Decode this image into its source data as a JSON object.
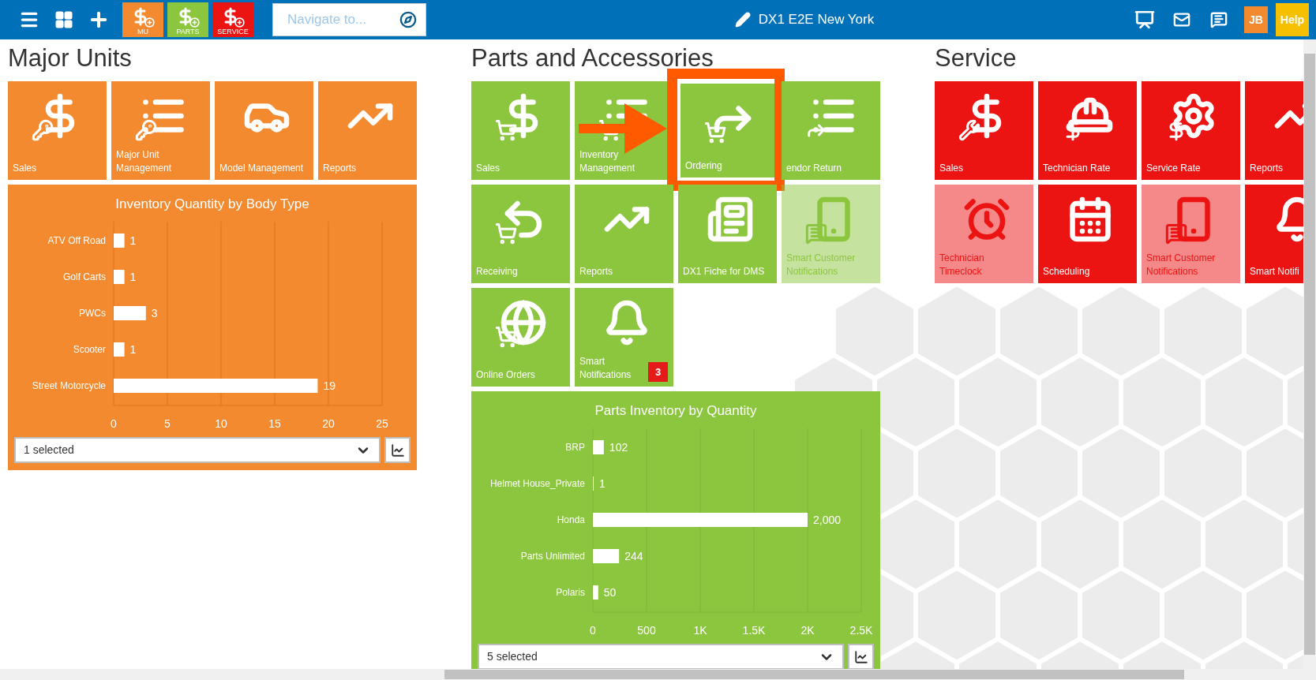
{
  "topbar": {
    "module_buttons": [
      {
        "label": "MU",
        "color": "#f38a2f"
      },
      {
        "label": "PARTS",
        "color": "#8cc63f"
      },
      {
        "label": "SERVICE",
        "color": "#ec1313"
      }
    ],
    "search": {
      "placeholder": "Navigate to..."
    },
    "title": "DX1 E2E New York",
    "user_initials": "JB",
    "help": "Help"
  },
  "sections": [
    {
      "title": "Major Units",
      "color": "#f38a2f",
      "tiles": [
        {
          "label": "Sales",
          "disabled": false,
          "highlighted": false
        },
        {
          "label": "Major Unit Management",
          "disabled": false,
          "highlighted": false
        },
        {
          "label": "Model Management",
          "disabled": false,
          "highlighted": false
        },
        {
          "label": "Reports",
          "disabled": false,
          "highlighted": false
        }
      ],
      "chart": {
        "selector": "1 selected",
        "chart_data": {
          "type": "bar",
          "orientation": "horizontal",
          "title": "Inventory Quantity by Body Type",
          "categories": [
            "ATV Off Road",
            "Golf Carts",
            "PWCs",
            "Scooter",
            "Street Motorcycle"
          ],
          "values": [
            1,
            1,
            3,
            1,
            19
          ],
          "value_labels": [
            "1",
            "1",
            "3",
            "1",
            "19"
          ],
          "grid": true,
          "xlim": [
            0,
            25
          ],
          "xticks": [
            0,
            5,
            10,
            15,
            20,
            25
          ]
        }
      }
    },
    {
      "title": "Parts and Accessories",
      "color": "#8cc63f",
      "tiles": [
        {
          "label": "Sales",
          "disabled": false,
          "highlighted": false
        },
        {
          "label": "Inventory Management",
          "disabled": false,
          "highlighted": false
        },
        {
          "label": "Ordering",
          "disabled": false,
          "highlighted": true
        },
        {
          "label": "endor Return",
          "disabled": false,
          "highlighted": false
        },
        {
          "label": "Receiving",
          "disabled": false,
          "highlighted": false
        },
        {
          "label": "Reports",
          "disabled": false,
          "highlighted": false
        },
        {
          "label": "DX1 Fiche for DMS",
          "disabled": false,
          "highlighted": false
        },
        {
          "label": "Smart Customer Notifications",
          "disabled": true,
          "highlighted": false
        },
        {
          "label": "Online Orders",
          "disabled": false,
          "highlighted": false
        },
        {
          "label": "Smart Notifications",
          "disabled": false,
          "highlighted": false,
          "badge": "3"
        }
      ],
      "chart": {
        "selector": "5 selected",
        "chart_data": {
          "type": "bar",
          "orientation": "horizontal",
          "title": "Parts Inventory by Quantity",
          "categories": [
            "BRP",
            "Helmet House_Private",
            "Honda",
            "Parts Unlimited",
            "Polaris"
          ],
          "values": [
            102,
            1,
            2000,
            244,
            50
          ],
          "value_labels": [
            "102",
            "1",
            "2,000",
            "244",
            "50"
          ],
          "grid": true,
          "xlim": [
            0,
            2500
          ],
          "xticks": [
            0,
            {
              "value": 500,
              "label": "500"
            },
            {
              "value": 1000,
              "label": "1K"
            },
            {
              "value": 1500,
              "label": "1.5K"
            },
            {
              "value": 2000,
              "label": "2K"
            },
            {
              "value": 2500,
              "label": "2.5K"
            }
          ]
        }
      }
    },
    {
      "title": "Service",
      "color": "#ec1313",
      "tiles": [
        {
          "label": "Sales",
          "disabled": false,
          "highlighted": false
        },
        {
          "label": "Technician Rate",
          "disabled": false,
          "highlighted": false
        },
        {
          "label": "Service Rate",
          "disabled": false,
          "highlighted": false
        },
        {
          "label": "Reports",
          "disabled": false,
          "highlighted": false
        },
        {
          "label": "Technician Timeclock",
          "disabled": true,
          "highlighted": false
        },
        {
          "label": "Scheduling",
          "disabled": false,
          "highlighted": false
        },
        {
          "label": "Smart Customer Notifications",
          "disabled": true,
          "highlighted": false
        },
        {
          "label": "Smart Notifi",
          "disabled": false,
          "highlighted": false
        }
      ]
    }
  ]
}
